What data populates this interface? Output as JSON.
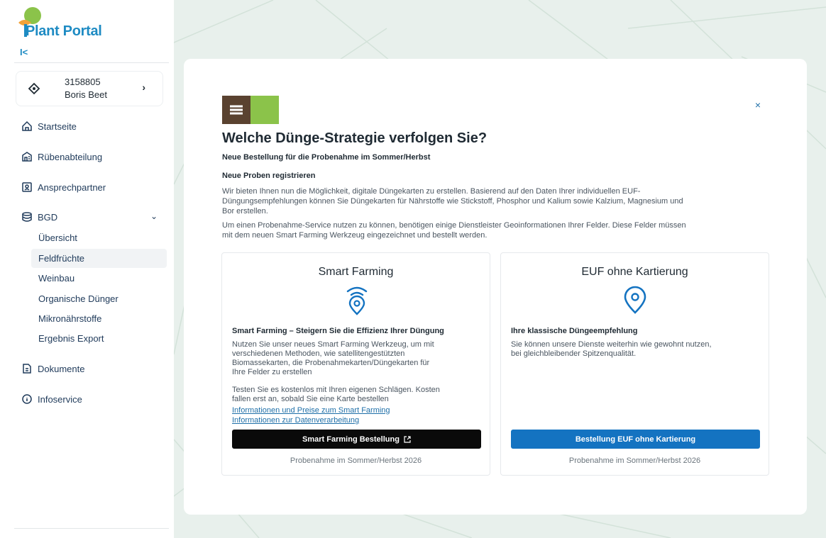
{
  "brand": {
    "name": "Plant Portal"
  },
  "sidebar": {
    "collapse_label": "I<",
    "account": {
      "id": "3158805",
      "name": "Boris Beet"
    },
    "nav": [
      {
        "label": "Startseite"
      },
      {
        "label": "Rübenabteilung"
      },
      {
        "label": "Ansprechpartner"
      },
      {
        "label": "BGD"
      }
    ],
    "bgd_items": [
      {
        "label": "Übersicht"
      },
      {
        "label": "Feldfrüchte"
      },
      {
        "label": "Weinbau"
      },
      {
        "label": "Organische Dünger"
      },
      {
        "label": "Mikronährstoffe"
      },
      {
        "label": "Ergebnis Export"
      }
    ],
    "nav_bottom": [
      {
        "label": "Dokumente"
      },
      {
        "label": "Infoservice"
      }
    ]
  },
  "modal": {
    "close": "×",
    "title": "Welche Dünge-Strategie verfolgen Sie?",
    "subtitle": "Neue Bestellung für die Probenahme im Sommer/Herbst",
    "section_heading": "Neue Proben registrieren",
    "para1_line1": "Wir bieten Ihnen nun die Möglichkeit, digitale Düngekarten zu erstellen. Basierend auf den Daten Ihrer individuellen EUF-",
    "para1_line2": "Düngungsempfehlungen können Sie Düngekarten für Nährstoffe wie Stickstoff, Phosphor und Kalium sowie Kalzium, Magnesium und",
    "para1_line3": "Bor erstellen.",
    "para2_line1": "Um einen Probenahme-Service nutzen zu können, benötigen einige Dienstleister Geoinformationen Ihrer Felder. Diese Felder müssen",
    "para2_line2": "mit dem neuen Smart Farming Werkzeug eingezeichnet und bestellt werden.",
    "cards": [
      {
        "title": "Smart Farming",
        "heading": "Smart Farming – Steigern Sie die Effizienz Ihrer Düngung",
        "p1_l1": "Nutzen Sie unser neues Smart Farming Werkzeug, um mit",
        "p1_l2": "verschiedenen Methoden, wie satellitengestützten",
        "p1_l3": "Biomassekarten, die Probenahmekarten/Düngekarten für",
        "p1_l4": "Ihre Felder zu erstellen",
        "p2_l1": "Testen Sie es kostenlos mit Ihren eigenen Schlägen. Kosten",
        "p2_l2": "fallen erst an, sobald Sie eine Karte bestellen",
        "link1": "Informationen und Preise zum Smart Farming",
        "link2": "Informationen zur Datenverarbeitung",
        "button": "Smart Farming Bestellung",
        "footer": "Probenahme im Sommer/Herbst 2026"
      },
      {
        "title": "EUF ohne Kartierung",
        "heading": "Ihre klassische Düngeempfehlung",
        "p1_l1": "Sie können unsere Dienste weiterhin wie gewohnt nutzen,",
        "p1_l2": "bei gleichbleibender Spitzenqualität.",
        "button": "Bestellung EUF ohne Kartierung",
        "footer": "Probenahme im Sommer/Herbst 2026"
      }
    ]
  },
  "colors": {
    "brand_blue": "#1e8bc3",
    "button_blue": "#1473c1",
    "button_dark": "#0a0a0a",
    "logo_green": "#8bc34a"
  },
  "icons": [
    "collapse-icon",
    "tag-icon",
    "chevron-right-icon",
    "home-icon",
    "building-icon",
    "contact-icon",
    "database-icon",
    "chevron-down-icon",
    "document-icon",
    "info-icon",
    "close-icon",
    "wifi-location-icon",
    "location-pin-icon",
    "external-link-icon"
  ]
}
